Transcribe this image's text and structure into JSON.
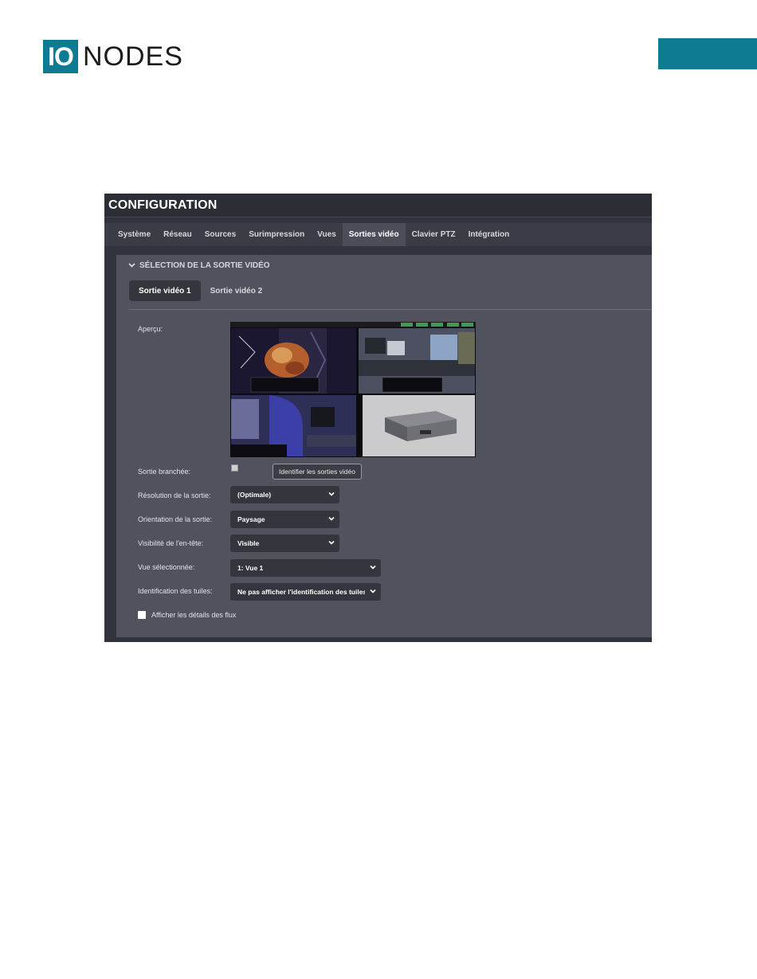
{
  "brand": {
    "logo_box": "IO",
    "logo_text": "NODES",
    "accent_color": "#0e7b93"
  },
  "app": {
    "title": "CONFIGURATION",
    "nav": [
      "Système",
      "Réseau",
      "Sources",
      "Surimpression",
      "Vues",
      "Sorties vidéo",
      "Clavier PTZ",
      "Intégration"
    ],
    "nav_active": "Sorties vidéo",
    "section": {
      "title": "SÉLECTION DE LA SORTIE VIDÉO",
      "subtabs": [
        "Sortie vidéo 1",
        "Sortie vidéo 2"
      ],
      "subtab_active": "Sortie vidéo 1",
      "preview_label": "Aperçu:",
      "output_connected_label": "Sortie branchée:",
      "identify_button": "Identifier les sorties vidéo",
      "resolution_label": "Résolution de la sortie:",
      "resolution_value": "(Optimale)",
      "orientation_label": "Orientation de la sortie:",
      "orientation_value": "Paysage",
      "header_visibility_label": "Visibilité de l'en-tête:",
      "header_visibility_value": "Visible",
      "selected_view_label": "Vue sélectionnée:",
      "selected_view_value": "1: Vue 1",
      "tile_id_label": "Identification des tuiles:",
      "tile_id_value": "Ne pas afficher l'identification des tuiles",
      "show_stream_details_label": "Afficher les détails des flux"
    }
  }
}
